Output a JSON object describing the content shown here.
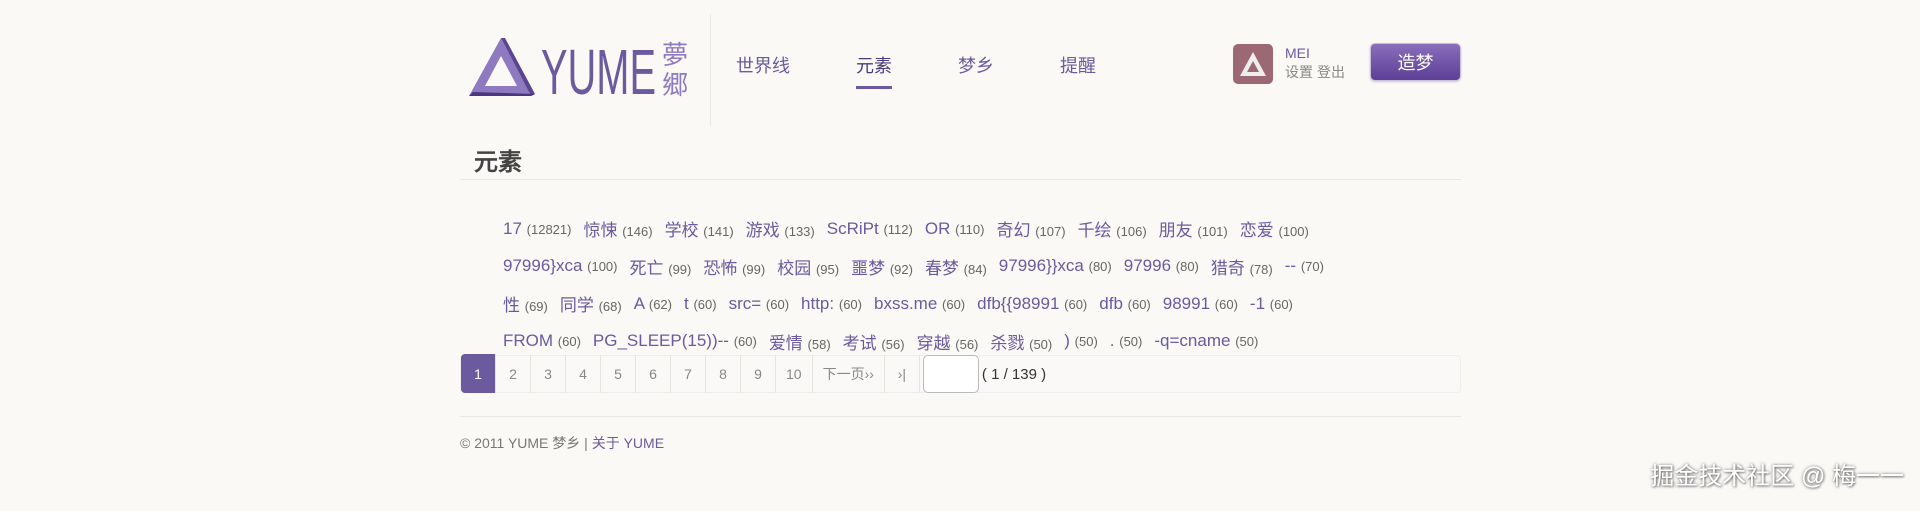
{
  "header": {
    "logo_text": "YUME 夢郷",
    "nav": [
      {
        "label": "世界线"
      },
      {
        "label": "元素",
        "active": true
      },
      {
        "label": "梦乡"
      },
      {
        "label": "提醒"
      }
    ],
    "user": {
      "name": "MEI",
      "settings": "设置",
      "logout": "登出"
    },
    "create_button": "造梦"
  },
  "page_title": "元素",
  "tags": [
    [
      {
        "name": "17",
        "count": "(12821)"
      },
      {
        "name": "惊悚",
        "count": "(146)"
      },
      {
        "name": "学校",
        "count": "(141)"
      },
      {
        "name": "游戏",
        "count": "(133)"
      },
      {
        "name": "ScRiPt",
        "count": "(112)"
      },
      {
        "name": "OR",
        "count": "(110)"
      },
      {
        "name": "奇幻",
        "count": "(107)"
      },
      {
        "name": "千绘",
        "count": "(106)"
      },
      {
        "name": "朋友",
        "count": "(101)"
      },
      {
        "name": "恋爱",
        "count": "(100)"
      }
    ],
    [
      {
        "name": "97996}xca",
        "count": "(100)"
      },
      {
        "name": "死亡",
        "count": "(99)"
      },
      {
        "name": "恐怖",
        "count": "(99)"
      },
      {
        "name": "校园",
        "count": "(95)"
      },
      {
        "name": "噩梦",
        "count": "(92)"
      },
      {
        "name": "春梦",
        "count": "(84)"
      },
      {
        "name": "97996}}xca",
        "count": "(80)"
      },
      {
        "name": "97996",
        "count": "(80)"
      },
      {
        "name": "猎奇",
        "count": "(78)"
      },
      {
        "name": "--",
        "count": "(70)"
      }
    ],
    [
      {
        "name": "性",
        "count": "(69)"
      },
      {
        "name": "同学",
        "count": "(68)"
      },
      {
        "name": "A",
        "count": "(62)"
      },
      {
        "name": "t",
        "count": "(60)"
      },
      {
        "name": "src=",
        "count": "(60)"
      },
      {
        "name": "http:",
        "count": "(60)"
      },
      {
        "name": "bxss.me",
        "count": "(60)"
      },
      {
        "name": "dfb{{98991",
        "count": "(60)"
      },
      {
        "name": "dfb",
        "count": "(60)"
      },
      {
        "name": "98991",
        "count": "(60)"
      },
      {
        "name": "-1",
        "count": "(60)"
      }
    ],
    [
      {
        "name": "FROM",
        "count": "(60)"
      },
      {
        "name": "PG_SLEEP(15))--",
        "count": "(60)"
      },
      {
        "name": "爱情",
        "count": "(58)"
      },
      {
        "name": "考试",
        "count": "(56)"
      },
      {
        "name": "穿越",
        "count": "(56)"
      },
      {
        "name": "杀戮",
        "count": "(50)"
      },
      {
        "name": ")",
        "count": "(50)"
      },
      {
        "name": ".",
        "count": "(50)"
      },
      {
        "name": "-q=cname",
        "count": "(50)"
      }
    ]
  ],
  "pagination": {
    "pages": [
      "1",
      "2",
      "3",
      "4",
      "5",
      "6",
      "7",
      "8",
      "9",
      "10"
    ],
    "current": "1",
    "next": "下一页››",
    "last": "›|",
    "jump_value": "",
    "total": "( 1 / 139 )"
  },
  "footer": {
    "copyright": "© 2011 YUME 梦乡 |",
    "about": "关于 YUME"
  },
  "watermark": "掘金技术社区 @ 梅一一",
  "colors": {
    "accent": "#6b5a9e",
    "background": "#fbf9f6"
  }
}
